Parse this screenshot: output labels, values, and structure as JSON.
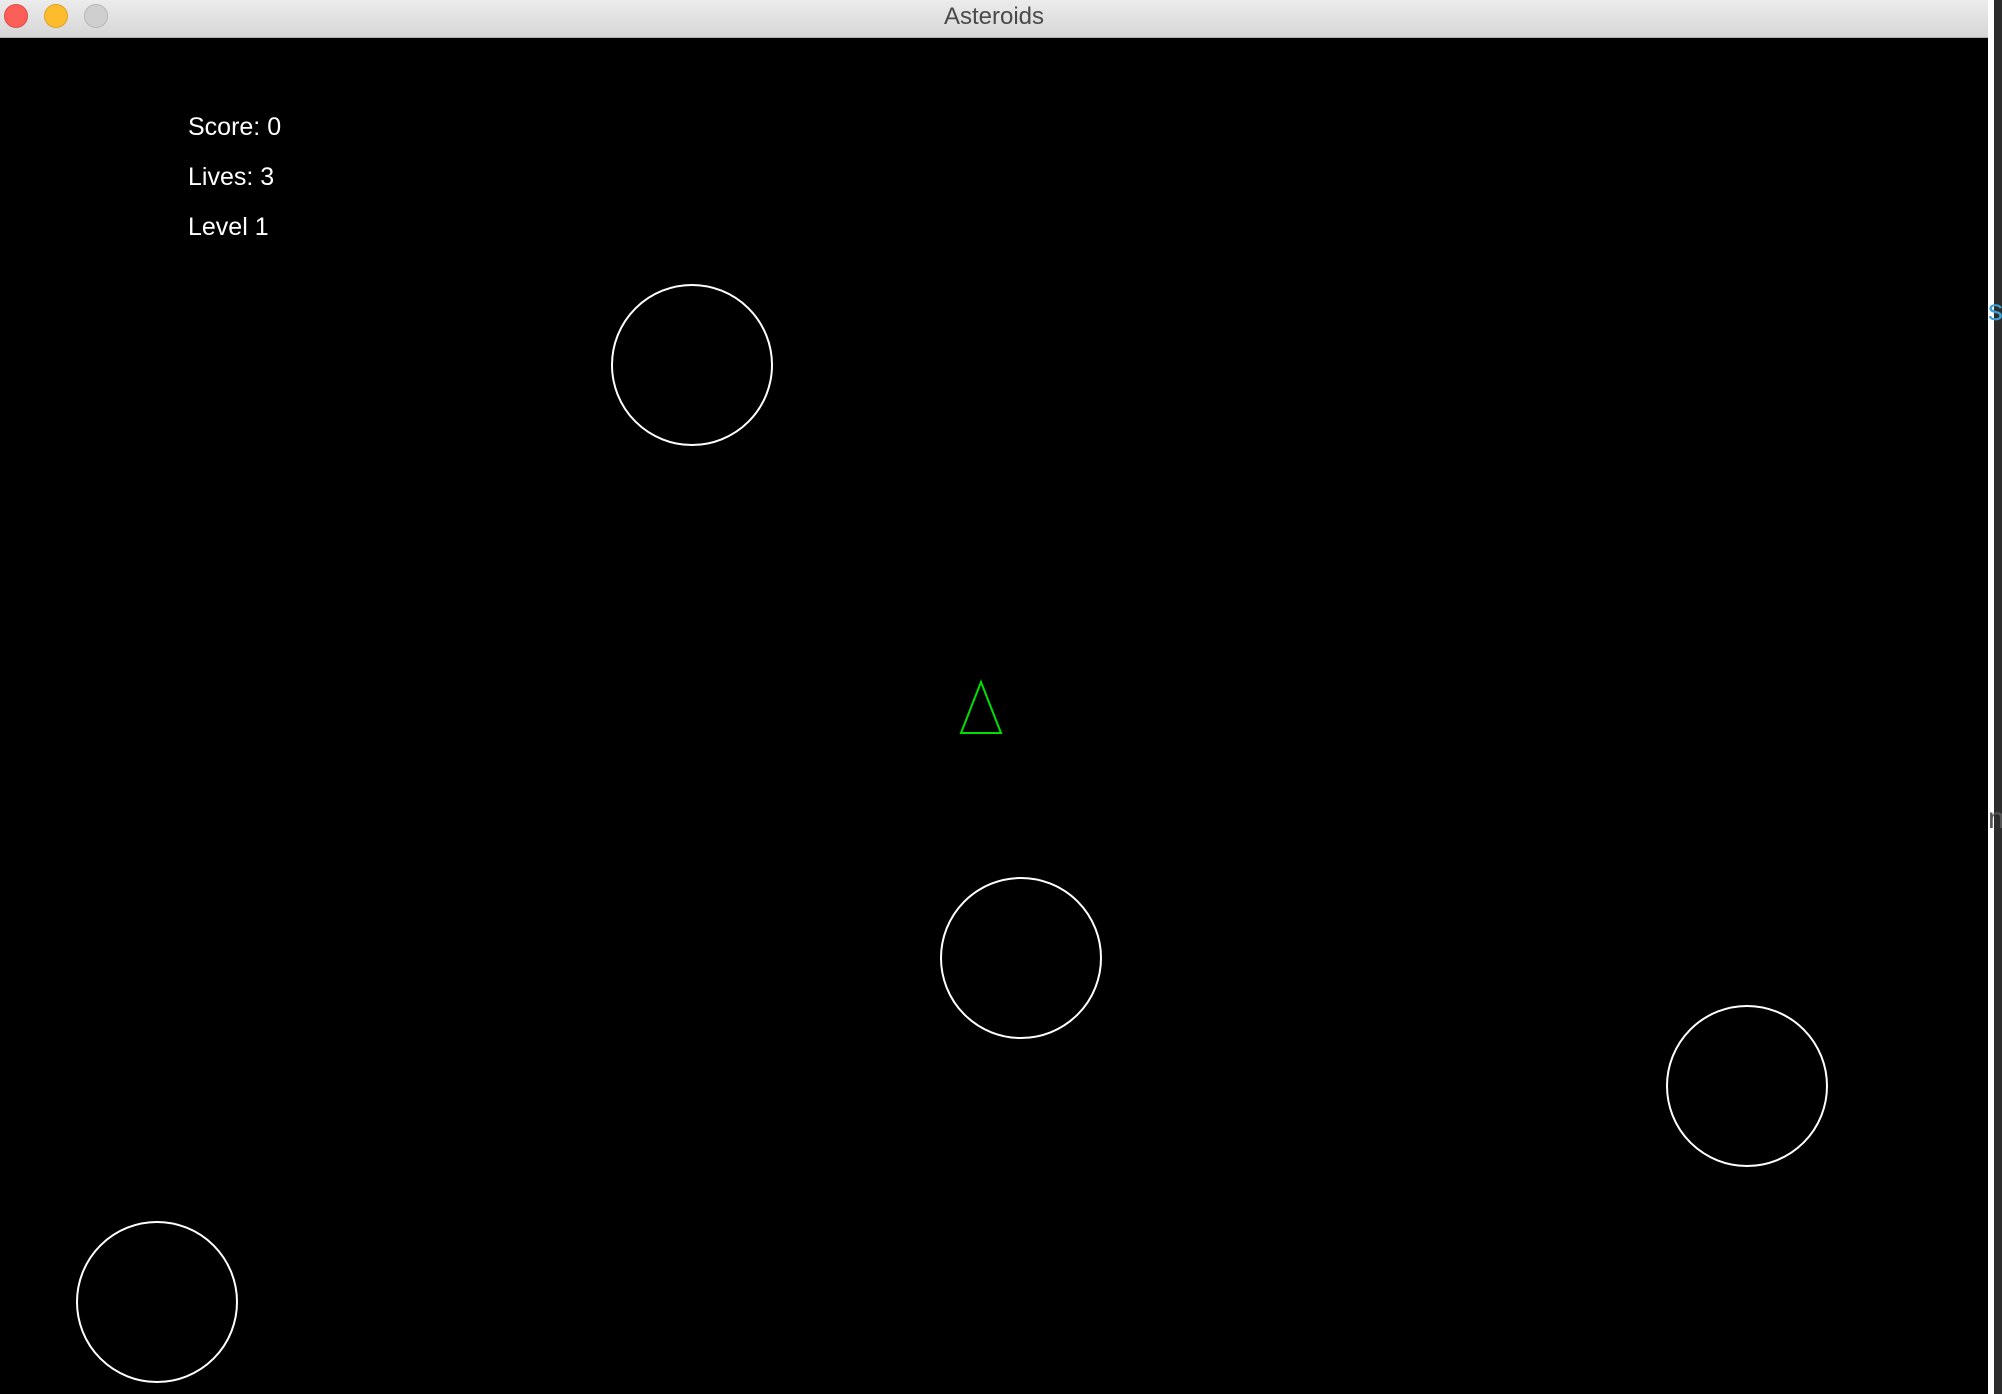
{
  "window": {
    "title": "Asteroids"
  },
  "hud": {
    "score": "Score: 0",
    "lives": "Lives: 3",
    "level": "Level 1"
  },
  "colors": {
    "background": "#000000",
    "hud_text": "#ffffff",
    "asteroid_outline": "#ffffff",
    "ship_outline": "#00e000",
    "traffic_close": "#fc5f57",
    "traffic_minimize": "#fdbc2e",
    "traffic_zoom": "#cfcfcf"
  },
  "game": {
    "ship_icon": "triangle-ship-icon",
    "asteroid_icon": "circle-asteroid-icon",
    "asteroid_count": 4
  },
  "background_window": {
    "visible_glyphs": [
      "s",
      "n"
    ]
  }
}
